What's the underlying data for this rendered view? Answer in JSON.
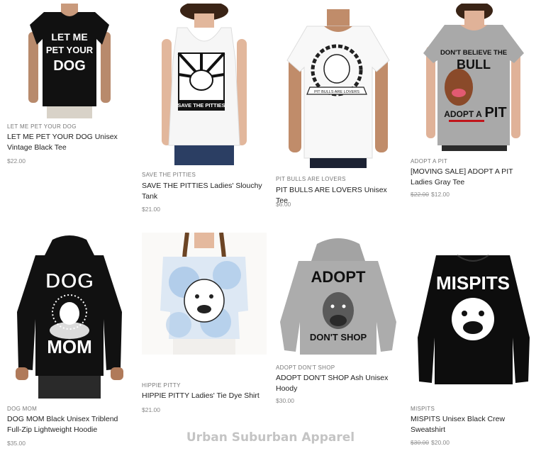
{
  "products": [
    {
      "vendor": "LET ME PET YOUR DOG",
      "title": "LET ME PET YOUR DOG Unisex Vintage Black Tee",
      "price": "$22.00",
      "image_text": [
        "LET ME",
        "PET YOUR",
        "DOG"
      ]
    },
    {
      "vendor": "SAVE THE PITTIES",
      "title": "SAVE THE PITTIES Ladies' Slouchy Tank",
      "price": "$21.00",
      "image_text": [
        "SAVE THE PITTIES"
      ]
    },
    {
      "vendor": "PIT BULLS ARE LOVERS",
      "title": "PIT BULLS ARE LOVERS Unisex Tee",
      "price": "$6.00",
      "image_text": [
        "PIT BULLS ARE LOVERS"
      ]
    },
    {
      "vendor": "ADOPT A PIT",
      "title": "[MOVING SALE] ADOPT A PIT Ladies Gray Tee",
      "price_old": "$22.00",
      "price": "$12.00",
      "image_text": [
        "DON'T BELIEVE THE",
        "BULL",
        "ADOPT A",
        "PIT"
      ]
    },
    {
      "vendor": "DOG MOM",
      "title": "DOG MOM Black Unisex Triblend Full-Zip Lightweight Hoodie",
      "price": "$35.00",
      "image_text": [
        "DOG",
        "MOM"
      ]
    },
    {
      "vendor": "HIPPIE PITTY",
      "title": "HIPPIE PITTY Ladies' Tie Dye Shirt",
      "price": "$21.00"
    },
    {
      "vendor": "ADOPT DON'T SHOP",
      "title": "ADOPT DON'T SHOP Ash Unisex Hoody",
      "price": "$30.00",
      "image_text": [
        "ADOPT",
        "DON'T SHOP"
      ]
    },
    {
      "vendor": "MISPITS",
      "title": "MISPITS Unisex Black Crew Sweatshirt",
      "price_old": "$30.00",
      "price": "$20.00",
      "image_text": [
        "MISPITS"
      ]
    }
  ],
  "footer": {
    "brand": "Urban Suburban Apparel"
  },
  "colors": {
    "black_shirt": "#111111",
    "gray_shirt": "#a9a9a9",
    "white_shirt": "#f4f4f4",
    "sale_red": "#c0151b"
  }
}
